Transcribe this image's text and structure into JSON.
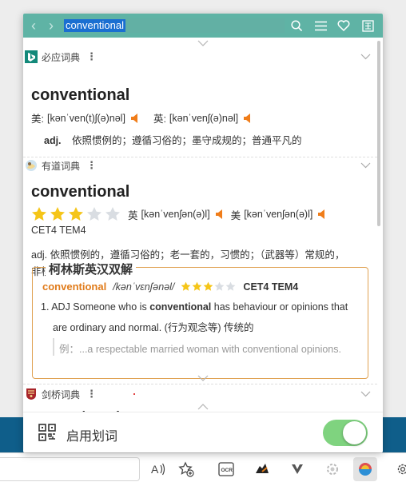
{
  "search": {
    "query": "conventional"
  },
  "header_icons": [
    "back-arrow-icon",
    "forward-arrow-icon",
    "search-icon",
    "menu-icon",
    "heart-icon",
    "dictionary-icon"
  ],
  "bing": {
    "name": "必应词典",
    "word": "conventional",
    "us_label": "美:",
    "us_ipa": "[kənˈven(t)ʃ(ə)nəl]",
    "uk_label": "英:",
    "uk_ipa": "[kənˈvenʃ(ə)nəl]",
    "pos": "adj.",
    "definition": "依照惯例的；遵循习俗的；墨守成规的；普通平凡的"
  },
  "youdao": {
    "name": "有道词典",
    "word": "conventional",
    "stars": 3,
    "stars_max": 5,
    "uk_label": "英",
    "uk_ipa": "[kənˈvenʃən(ə)l]",
    "us_label": "美",
    "us_ipa": "[kənˈvenʃən(ə)l]",
    "tags": "CET4 TEM4",
    "definition_line1": "adj. 依照惯例的，遵循习俗的；老一套的，习惯的；（武器等）常规的，",
    "definition_line2": "非核的",
    "collins": {
      "title": "柯林斯英汉双解",
      "word": "conventional",
      "ipa": "/kənˈvɛnʃənəl/",
      "stars": 3,
      "stars_max": 5,
      "tags": "CET4 TEM4",
      "sense_prefix": "1. ADJ Someone who is ",
      "sense_bold": "conventional",
      "sense_suffix": " has behaviour or opinions that",
      "sense_line2": "are ordinary and normal. (行为观念等) 传统的",
      "example_label": "例：",
      "example": "...a respectable married woman with conventional opinions."
    }
  },
  "cambridge": {
    "name": "剑桥词典",
    "word": "conventional"
  },
  "footer": {
    "label": "启用划词",
    "toggle_on": true
  },
  "colors": {
    "accent": "#5fb3a5",
    "speaker": "#f07d1a",
    "star": "#f5c518",
    "collins_border": "#e0a253",
    "toggle": "#7fd37f"
  }
}
